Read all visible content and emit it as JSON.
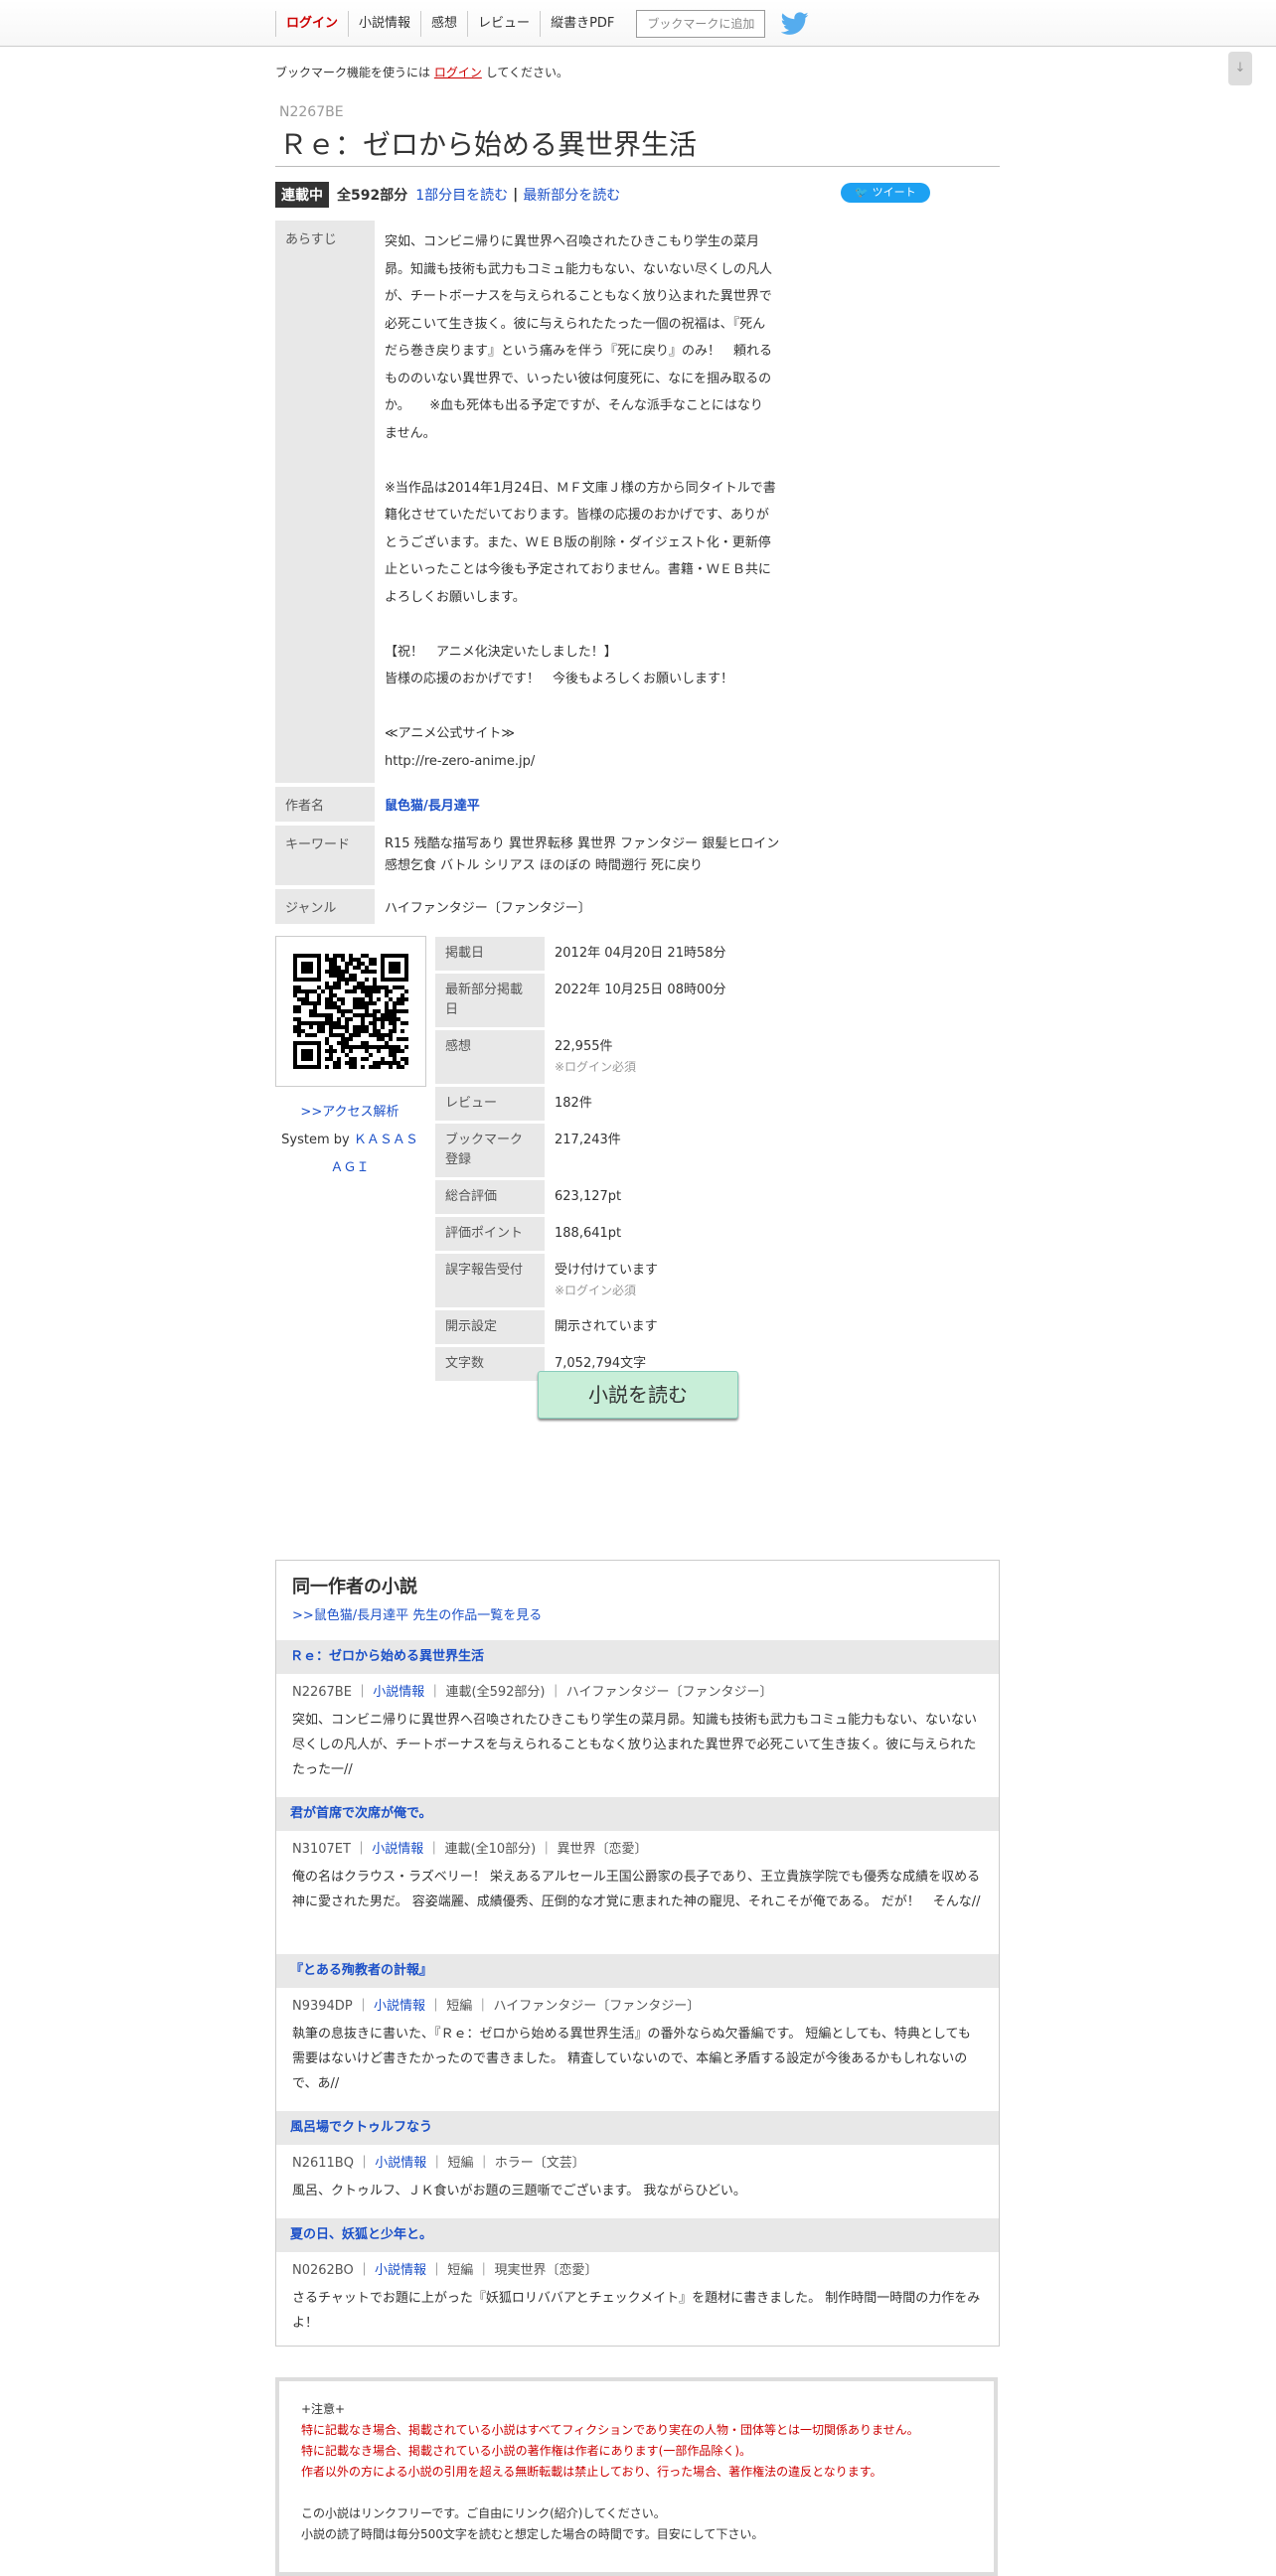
{
  "nav": {
    "login": "ログイン",
    "info": "小説情報",
    "impressions": "感想",
    "review": "レビュー",
    "pdf": "縦書きPDF",
    "bookmark_button": "ブックマークに追加"
  },
  "scroll_label": "↓",
  "notice": {
    "before": "ブックマーク機能を使うには",
    "link": "ログイン",
    "after": "してください。"
  },
  "novel": {
    "ncode": "N2267BE",
    "title": "Ｒｅ：ゼロから始める異世界生活",
    "status": "連載中",
    "total": "全592部分",
    "first_link": "1部分目を読む",
    "sep": "|",
    "latest_link": "最新部分を読む",
    "tweet": "ツイート"
  },
  "info": {
    "synopsis_label": "あらすじ",
    "synopsis": "突如、コンビニ帰りに異世界へ召喚されたひきこもり学生の菜月\n昴。知識も技術も武力もコミュ能力もない、ないない尽くしの凡人\nが、チートボーナスを与えられることもなく放り込まれた異世界で\n必死こいて生き抜く。彼に与えられたたった一個の祝福は、『死ん\nだら巻き戻ります』という痛みを伴う『死に戻り』のみ！　頼れる\nもののいない異世界で、いったい彼は何度死に、なにを掴み取るの\nか。　　※血も死体も出る予定ですが、そんな派手なことにはなり\nません。\n\n※当作品は2014年1月24日、ＭＦ文庫Ｊ様の方から同タイトルで書\n籍化させていただいております。皆様の応援のおかげです、ありが\nとうございます。また、ＷＥＢ版の削除・ダイジェスト化・更新停\n止といったことは今後も予定されておりません。書籍・ＷＥＢ共に\nよろしくお願いします。\n\n【祝！　アニメ化決定いたしました！】\n皆様の応援のおかげです！　今後もよろしくお願いします！\n\n≪アニメ公式サイト≫\nhttp://re-zero-anime.jp/",
    "author_label": "作者名",
    "author": "鼠色猫/長月達平",
    "keyword_label": "キーワード",
    "keywords_line1": "R15 残酷な描写あり 異世界転移  異世界 ファンタジー 銀髪ヒロイン",
    "keywords_line2": "感想乞食 バトル シリアス ほのぼの 時間遡行 死に戻り",
    "genre_label": "ジャンル",
    "genre": "ハイファンタジー〔ファンタジー〕"
  },
  "qr": {
    "access_link": ">>アクセス解析",
    "system_by": "System by",
    "kasasagi_1": "ＫＡＳＡＳ",
    "kasasagi_2": "ＡＧＩ"
  },
  "meta": [
    {
      "label": "掲載日",
      "value": "2012年 04月20日 21時58分",
      "sub": ""
    },
    {
      "label": "最新部分掲載日",
      "value": "2022年 10月25日 08時00分",
      "sub": ""
    },
    {
      "label": "感想",
      "value": "22,955件",
      "sub": "※ログイン必須"
    },
    {
      "label": "レビュー",
      "value": "182件",
      "sub": ""
    },
    {
      "label": "ブックマーク登録",
      "value": "217,243件",
      "sub": ""
    },
    {
      "label": "総合評価",
      "value": "623,127pt",
      "sub": ""
    },
    {
      "label": "評価ポイント",
      "value": "188,641pt",
      "sub": ""
    },
    {
      "label": "誤字報告受付",
      "value": "受け付けています",
      "sub": "※ログイン必須"
    },
    {
      "label": "開示設定",
      "value": "開示されています",
      "sub": ""
    },
    {
      "label": "文字数",
      "value": "7,052,794文字",
      "sub": ""
    }
  ],
  "read_button": "小説を読む",
  "works": {
    "title": "同一作者の小説",
    "all_link": ">>鼠色猫/長月達平 先生の作品一覧を見る",
    "items": [
      {
        "title": "Ｒｅ：ゼロから始める異世界生活",
        "code": "N2267BE",
        "info_link": "小説情報",
        "meta": "連載(全592部分) ｜ ハイファンタジー〔ファンタジー〕",
        "desc": "突如、コンビニ帰りに異世界へ召喚されたひきこもり学生の菜月昴。知識も技術も武力もコミュ能力もない、ないない尽くしの凡人が、チートボーナスを与えられることもなく放り込まれた異世界で必死こいて生き抜く。彼に与えられたたった一//"
      },
      {
        "title": "君が首席で次席が俺で。",
        "code": "N3107ET",
        "info_link": "小説情報",
        "meta": "連載(全10部分) ｜ 異世界〔恋愛〕",
        "desc": "俺の名はクラウス・ラズベリー！ 栄えあるアルセール王国公爵家の長子であり、王立貴族学院でも優秀な成績を収める神に愛された男だ。 容姿端麗、成績優秀、圧倒的な才覚に恵まれた神の寵児、それこそが俺である。 だが！　そんな//"
      },
      {
        "title": "『とある殉教者の計報』",
        "code": "N9394DP",
        "info_link": "小説情報",
        "meta": "短編 ｜ ハイファンタジー〔ファンタジー〕",
        "desc": "執筆の息抜きに書いた、『Ｒｅ：ゼロから始める異世界生活』の番外ならぬ欠番編です。 短編としても、特典としても需要はないけど書きたかったので書きました。 精査していないので、本編と矛盾する設定が今後あるかもしれないので、あ//"
      },
      {
        "title": "風呂場でクトゥルフなう",
        "code": "N2611BQ",
        "info_link": "小説情報",
        "meta": "短編 ｜ ホラー〔文芸〕",
        "desc": "風呂、クトゥルフ、ＪＫ食いがお題の三題噺でございます。 我ながらひどい。"
      },
      {
        "title": "夏の日、妖狐と少年と。",
        "code": "N0262BO",
        "info_link": "小説情報",
        "meta": "短編 ｜ 現実世界〔恋愛〕",
        "desc": "さるチャットでお題に上がった『妖狐ロリババアとチェックメイト』を題材に書きました。 制作時間一時間の力作をみよ！"
      }
    ]
  },
  "footer": {
    "heading": "+注意+",
    "warn1": "特に記載なき場合、掲載されている小説はすべてフィクションであり実在の人物・団体等とは一切関係ありません。",
    "warn2": "特に記載なき場合、掲載されている小説の著作権は作者にあります(一部作品除く)。",
    "warn3": "作者以外の方による小説の引用を超える無断転載は禁止しており、行った場合、著作権法の違反となります。",
    "link_free": "この小説はリンクフリーです。ご自由にリンク(紹介)してください。",
    "reading_time": "小説の読了時間は毎分500文字を読むと想定した場合の時間です。目安にして下さい。"
  }
}
